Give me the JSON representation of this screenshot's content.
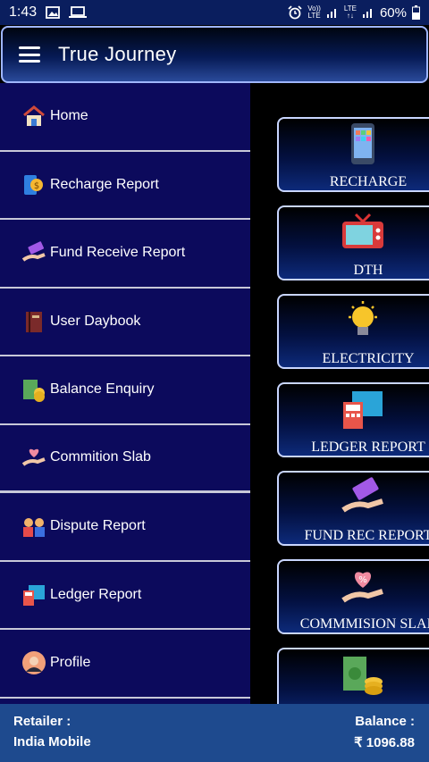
{
  "status_bar": {
    "time": "1:43",
    "battery": "60%",
    "volte": "Vo))",
    "lte1": "LTE",
    "lte2": "LTE"
  },
  "app_bar": {
    "title": "True Journey"
  },
  "drawer": {
    "items": [
      {
        "label": "Home",
        "icon": "home-icon"
      },
      {
        "label": "Recharge Report",
        "icon": "recharge-report-icon"
      },
      {
        "label": "Fund Receive Report",
        "icon": "fund-receive-icon"
      },
      {
        "label": "User Daybook",
        "icon": "daybook-icon"
      },
      {
        "label": "Balance Enquiry",
        "icon": "money-icon"
      },
      {
        "label": "Commition Slab",
        "icon": "commission-icon"
      },
      {
        "label": "Dispute Report",
        "icon": "dispute-icon"
      },
      {
        "label": "Ledger Report",
        "icon": "ledger-icon"
      },
      {
        "label": "Profile",
        "icon": "profile-icon"
      }
    ]
  },
  "cards": [
    {
      "label": "RECHARGE",
      "icon": "mobile-phone-icon"
    },
    {
      "label": "DTH",
      "icon": "tv-icon"
    },
    {
      "label": "ELECTRICITY",
      "icon": "light-bulb-icon"
    },
    {
      "label": "LEDGER REPORT",
      "icon": "ledger-icon"
    },
    {
      "label": "FUND REC REPORT",
      "icon": "fund-receive-icon"
    },
    {
      "label": "COMMMISION SLAB",
      "icon": "commission-icon"
    },
    {
      "label": "",
      "icon": "money-icon"
    }
  ],
  "footer": {
    "retailer_label": "Retailer :",
    "retailer_name": "India Mobile",
    "balance_label": "Balance :",
    "balance_value": "₹ 1096.88"
  },
  "colors": {
    "drawer_bg": "#0c0a5c",
    "footer_bg": "#1e4a8e",
    "card_border": "#c9d6ff"
  }
}
